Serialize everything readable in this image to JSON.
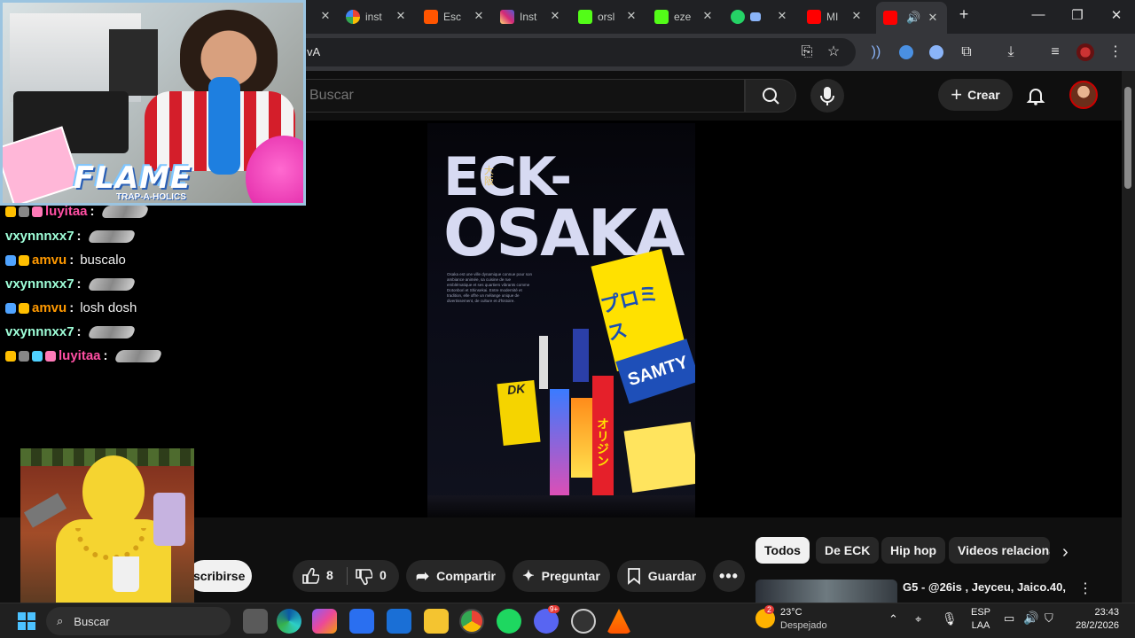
{
  "browser": {
    "tabs": [
      {
        "title": "inst",
        "icon": "google-icon",
        "color": "#ffffff"
      },
      {
        "title": "Esc",
        "icon": "soundcloud-icon",
        "color": "#ff5500"
      },
      {
        "title": "Inst",
        "icon": "instagram-icon",
        "color": "#d62976"
      },
      {
        "title": "orsl",
        "icon": "kick-icon",
        "color": "#53fc18"
      },
      {
        "title": "eze",
        "icon": "kick-icon",
        "color": "#53fc18"
      },
      {
        "title": "",
        "icon": "whatsapp-icon",
        "color": "#25d366"
      },
      {
        "title": "MI",
        "icon": "youtube-icon",
        "color": "#ff0000"
      },
      {
        "title": "",
        "icon": "youtube-icon",
        "color": "#ff0000"
      }
    ],
    "url_fragment": "vA"
  },
  "youtube": {
    "search_placeholder": "Buscar",
    "create_label": "Crear",
    "subscribe_label": "scribirse",
    "like_count": "8",
    "dislike_count": "0",
    "share_label": "Compartir",
    "ask_label": "Preguntar",
    "save_label": "Guardar",
    "chips": [
      "Todos",
      "De ECK",
      "Hip hop",
      "Videos relaciona"
    ],
    "related": {
      "title": "G5 -  @26is  , Jeyceu, Jaico.40,"
    },
    "poster": {
      "title_line1": "ECK-",
      "title_line2": "OSAKA",
      "kanji": "大阪",
      "blurb": "Osaka est une ville dynamique connue pour son ambiance animée, sa cuisine de rue emblématique et ses quartiers vibrants comme Dotonbori et Shinsekai. Entre modernité et tradition, elle offre un mélange unique de divertissement, de culture et d'histoire.",
      "signs": [
        "プロミス",
        "SAMTY",
        "オリジン",
        "DK"
      ]
    }
  },
  "stream": {
    "banner_text": "FLAME",
    "banner_sub": "TRAP-A-HOLICS",
    "chat": [
      {
        "user": "luyitaa",
        "message": "",
        "color": "#ff4fa3",
        "badges": [
          "#ffbf00",
          "#888888",
          "#ff7ab8"
        ]
      },
      {
        "user": "vxynnnxx7",
        "message": "",
        "color": "#9fffd9",
        "badges": []
      },
      {
        "user": "amvu",
        "message": "buscalo",
        "color": "#ff9900",
        "badges": [
          "#4fa3ff",
          "#ffbf00"
        ]
      },
      {
        "user": "vxynnnxx7",
        "message": "",
        "color": "#9fffd9",
        "badges": []
      },
      {
        "user": "amvu",
        "message": "losh dosh",
        "color": "#ff9900",
        "badges": [
          "#4fa3ff",
          "#ffbf00"
        ]
      },
      {
        "user": "vxynnnxx7",
        "message": "",
        "color": "#9fffd9",
        "badges": []
      },
      {
        "user": "luyitaa",
        "message": "",
        "color": "#ff4fa3",
        "badges": [
          "#ffbf00",
          "#888888",
          "#4fd1ff",
          "#ff7ab8"
        ]
      }
    ]
  },
  "taskbar": {
    "search_placeholder": "Buscar",
    "weather_temp": "23°C",
    "weather_desc": "Despejado",
    "weather_badge": "2",
    "lang_top": "ESP",
    "lang_bottom": "LAA",
    "time": "23:43",
    "date": "28/2/2026",
    "discord_badge": "9+"
  }
}
